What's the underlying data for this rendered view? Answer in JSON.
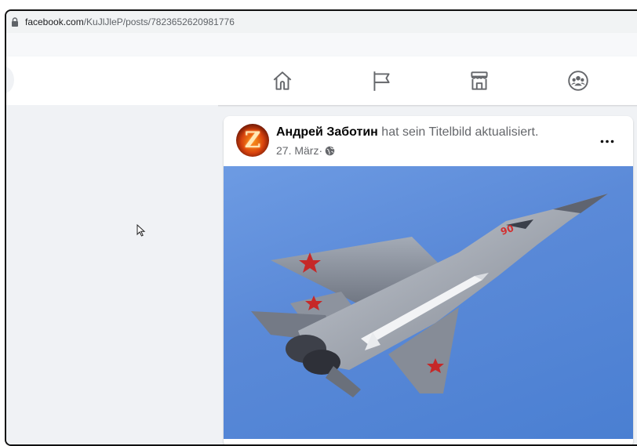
{
  "browser": {
    "url_host": "facebook.com",
    "url_path": "/KuJlJleP/posts/7823652620981776"
  },
  "nav": {
    "items": [
      {
        "name": "home-icon"
      },
      {
        "name": "pages-flag-icon"
      },
      {
        "name": "marketplace-icon"
      },
      {
        "name": "groups-icon"
      }
    ]
  },
  "post": {
    "author": "Андрей Заботин",
    "action": " hat sein Titelbild aktualisiert.",
    "date": "27. März",
    "separator": " · ",
    "avatar_letter": "Z",
    "privacy_icon": "globe-icon",
    "menu_icon": "more-icon"
  },
  "colors": {
    "text_primary": "#050505",
    "text_secondary": "#65676b",
    "sky": "#5b8ad8",
    "page_bg": "#f0f2f5"
  }
}
